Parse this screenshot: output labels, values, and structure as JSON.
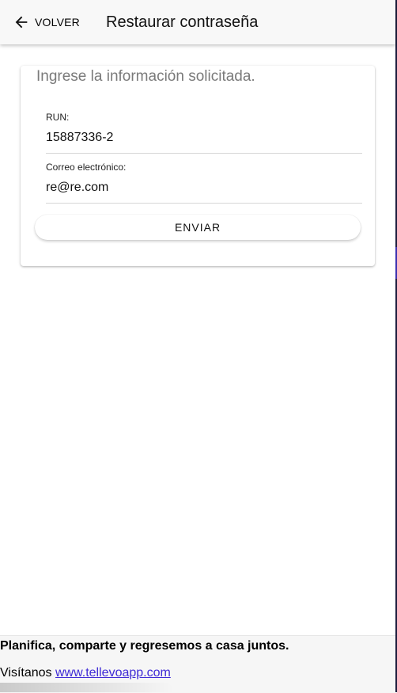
{
  "header": {
    "back_label": "VOLVER",
    "back_icon": "arrow-left-icon",
    "title": "Restaurar contraseña"
  },
  "form": {
    "subtitle": "Ingrese la información solicitada.",
    "run": {
      "label": "RUN:",
      "value": "15887336-2"
    },
    "email": {
      "label": "Correo electrónico:",
      "value": "re@re.com"
    },
    "submit_label": "ENVIAR"
  },
  "footer": {
    "tagline": "Planifica, comparte y regresemos a casa juntos.",
    "visit_prefix": "Visítanos",
    "link_text": "www.tellevoapp.com"
  },
  "colors": {
    "link": "#3f2bd6",
    "subtitle": "#7a7a7a",
    "toolbar_bg": "#f8f8f8"
  }
}
